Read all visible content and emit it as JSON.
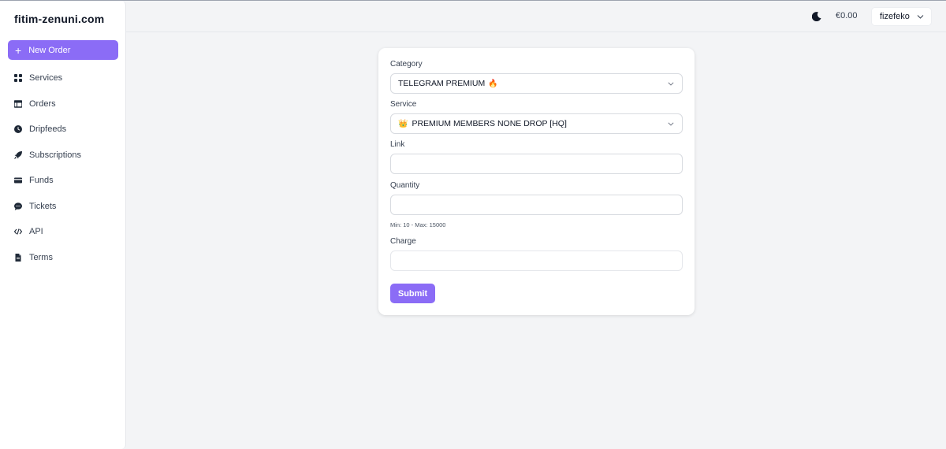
{
  "brand": "fitim-zenuni.com",
  "sidebar": {
    "new_order_label": "New Order",
    "items": [
      {
        "label": "Services",
        "icon": "grid-icon"
      },
      {
        "label": "Orders",
        "icon": "table-icon"
      },
      {
        "label": "Dripfeeds",
        "icon": "clock-icon"
      },
      {
        "label": "Subscriptions",
        "icon": "rocket-icon"
      },
      {
        "label": "Funds",
        "icon": "credit-card-icon"
      },
      {
        "label": "Tickets",
        "icon": "chat-bubble-icon"
      },
      {
        "label": "API",
        "icon": "code-icon"
      },
      {
        "label": "Terms",
        "icon": "document-icon"
      }
    ]
  },
  "header": {
    "balance": "€0.00",
    "username": "fizefeko"
  },
  "form": {
    "category_label": "Category",
    "category_value": "TELEGRAM PREMIUM",
    "category_emoji": "🔥",
    "service_label": "Service",
    "service_emoji": "👑",
    "service_value": "PREMIUM MEMBERS NONE DROP [HQ]",
    "link_label": "Link",
    "link_value": "",
    "quantity_label": "Quantity",
    "quantity_value": "",
    "quantity_hint": "Min: 10 - Max: 15000",
    "charge_label": "Charge",
    "charge_value": "",
    "submit_label": "Submit"
  },
  "colors": {
    "accent": "#8b6cf6",
    "background": "#f3f4f6"
  }
}
